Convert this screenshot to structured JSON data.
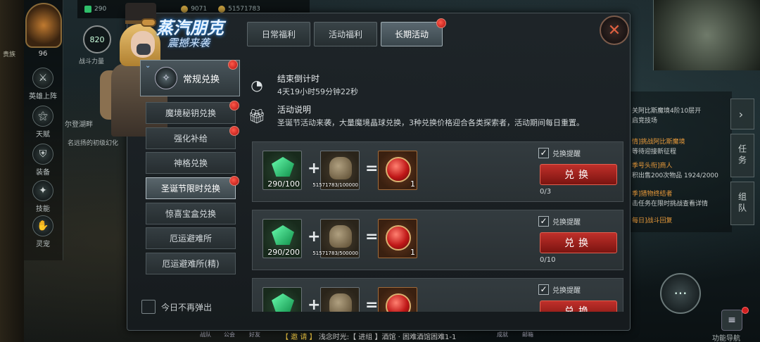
{
  "background": {
    "resources": {
      "gems": "290",
      "gold": "9071",
      "coins": "51571783"
    },
    "power": "820",
    "power_label": "战斗力量",
    "level": "96",
    "left_edge": [
      "贵族"
    ],
    "nav": [
      {
        "label": "英雄上阵",
        "icon": "hero-icon",
        "glyph": "⚔"
      },
      {
        "label": "天赋",
        "icon": "talent-icon",
        "glyph": "⚝"
      },
      {
        "label": "装备",
        "icon": "armor-icon",
        "glyph": "⛨"
      },
      {
        "label": "技能",
        "icon": "skill-icon",
        "glyph": "✦"
      },
      {
        "label": "灵宠",
        "icon": "pet-icon",
        "glyph": "✋"
      }
    ],
    "world_texts": [
      "尔登湖畔",
      "名远扬的初级幻化"
    ],
    "quests": [
      {
        "text": "关阿比斯魔境4阶10层开",
        "orange": false
      },
      {
        "text": "启竞技场",
        "orange": false
      },
      {
        "text": "情]挑战阿比斯魔境",
        "orange": true
      },
      {
        "text": "等待迎接新征程",
        "orange": false
      },
      {
        "text": "季号头衔]商人",
        "orange": true
      },
      {
        "text": "积出售200次物品 1924/2000",
        "orange": false
      },
      {
        "text": "季]猎物终结者",
        "orange": true
      },
      {
        "text": "击任务在限时挑战查看详情",
        "orange": false
      },
      {
        "text": "每日]战斗回复",
        "orange": true
      }
    ],
    "right_tabs": [
      "任务",
      "组队"
    ],
    "chat_prefix": "【 邀 请 】",
    "chat_text": "浅念时光:【 进组 】酒馆 · 困难酒馆困难1-1",
    "bottom_buttons": [
      "战队",
      "公会",
      "好友",
      "成就",
      "邮箱"
    ],
    "func_nav_label": "功能导航"
  },
  "dialog": {
    "title": "蒸汽朋克",
    "subtitle": "震撼来袭",
    "tabs": [
      {
        "label": "日常福利",
        "active": false
      },
      {
        "label": "活动福利",
        "active": false
      },
      {
        "label": "长期活动",
        "active": true
      }
    ],
    "side_head": "常规兑换",
    "side_items": [
      {
        "label": "魔境秘钥兑换",
        "dot": true,
        "active": false
      },
      {
        "label": "强化补给",
        "dot": true,
        "active": false
      },
      {
        "label": "神格兑换",
        "dot": false,
        "active": false
      },
      {
        "label": "圣诞节限时兑换",
        "dot": true,
        "active": true
      },
      {
        "label": "惊喜宝盒兑换",
        "dot": false,
        "active": false
      },
      {
        "label": "厄运避难所",
        "dot": false,
        "active": false
      },
      {
        "label": "厄运避难所(精)",
        "dot": false,
        "active": false
      }
    ],
    "no_popup_label": "今日不再弹出",
    "countdown_title": "结束倒计时",
    "countdown_value": "4天19小时59分钟22秒",
    "desc_title": "活动说明",
    "desc_text": "圣诞节活动来袭，大量魔境晶球兑换，3种兑换价格迎合各类探索者，活动期间每日重置。",
    "rows": [
      {
        "gem_count": "290/100",
        "gold_count": "51571783/100000",
        "reward_count": "1",
        "remind": "兑换提醒",
        "button": "兑换",
        "limit": "0/3"
      },
      {
        "gem_count": "290/200",
        "gold_count": "51571783/500000",
        "reward_count": "1",
        "remind": "兑换提醒",
        "button": "兑换",
        "limit": "0/10"
      },
      {
        "gem_count": "",
        "gold_count": "",
        "reward_count": "",
        "remind": "兑换提醒",
        "button": "兑换",
        "limit": ""
      }
    ],
    "plus": "+",
    "equals": "="
  }
}
